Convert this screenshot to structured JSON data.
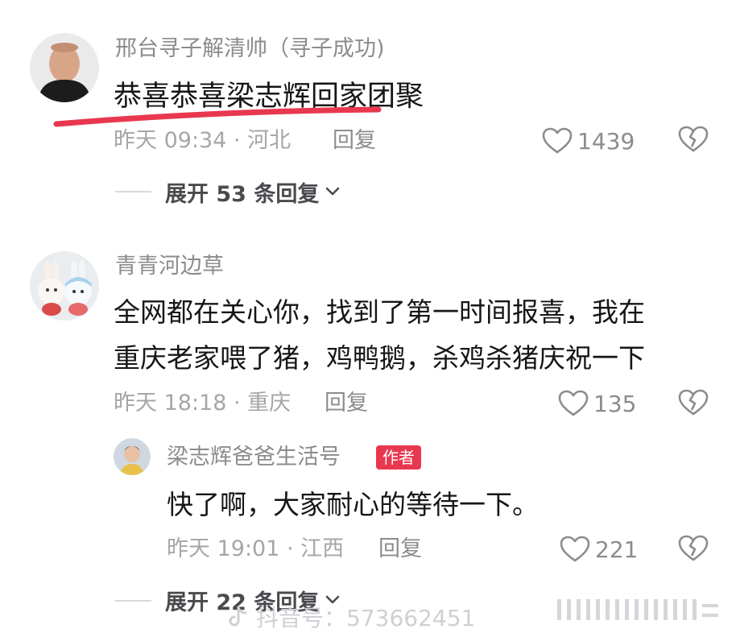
{
  "comments": [
    {
      "author": "邢台寻子解清帅（寻子成功)",
      "text": "恭喜恭喜梁志辉回家团聚",
      "time_location": "昨天 09:34 · 河北",
      "reply_label": "回复",
      "likes": "1439",
      "expand_label": "展开 53 条回复"
    },
    {
      "author": "青青河边草",
      "text_line1": "全网都在关心你，找到了第一时间报喜，我在",
      "text_line2": "重庆老家喂了猪，鸡鸭鹅，杀鸡杀猪庆祝一下",
      "time_location": "昨天 18:18 · 重庆",
      "reply_label": "回复",
      "likes": "135"
    }
  ],
  "reply": {
    "author": "梁志辉爸爸生活号",
    "badge": "作者",
    "text": "快了啊，大家耐心的等待一下。",
    "time_location": "昨天 19:01 · 江西",
    "reply_label": "回复",
    "likes": "221",
    "expand_label": "展开 22 条回复"
  },
  "watermark": {
    "text": "抖音号：573662451"
  },
  "colors": {
    "underline": "#e8384f",
    "badge": "#e8384f"
  },
  "icons": [
    "heart-icon",
    "broken-heart-icon",
    "chevron-down-icon",
    "tiktok-logo-icon"
  ]
}
